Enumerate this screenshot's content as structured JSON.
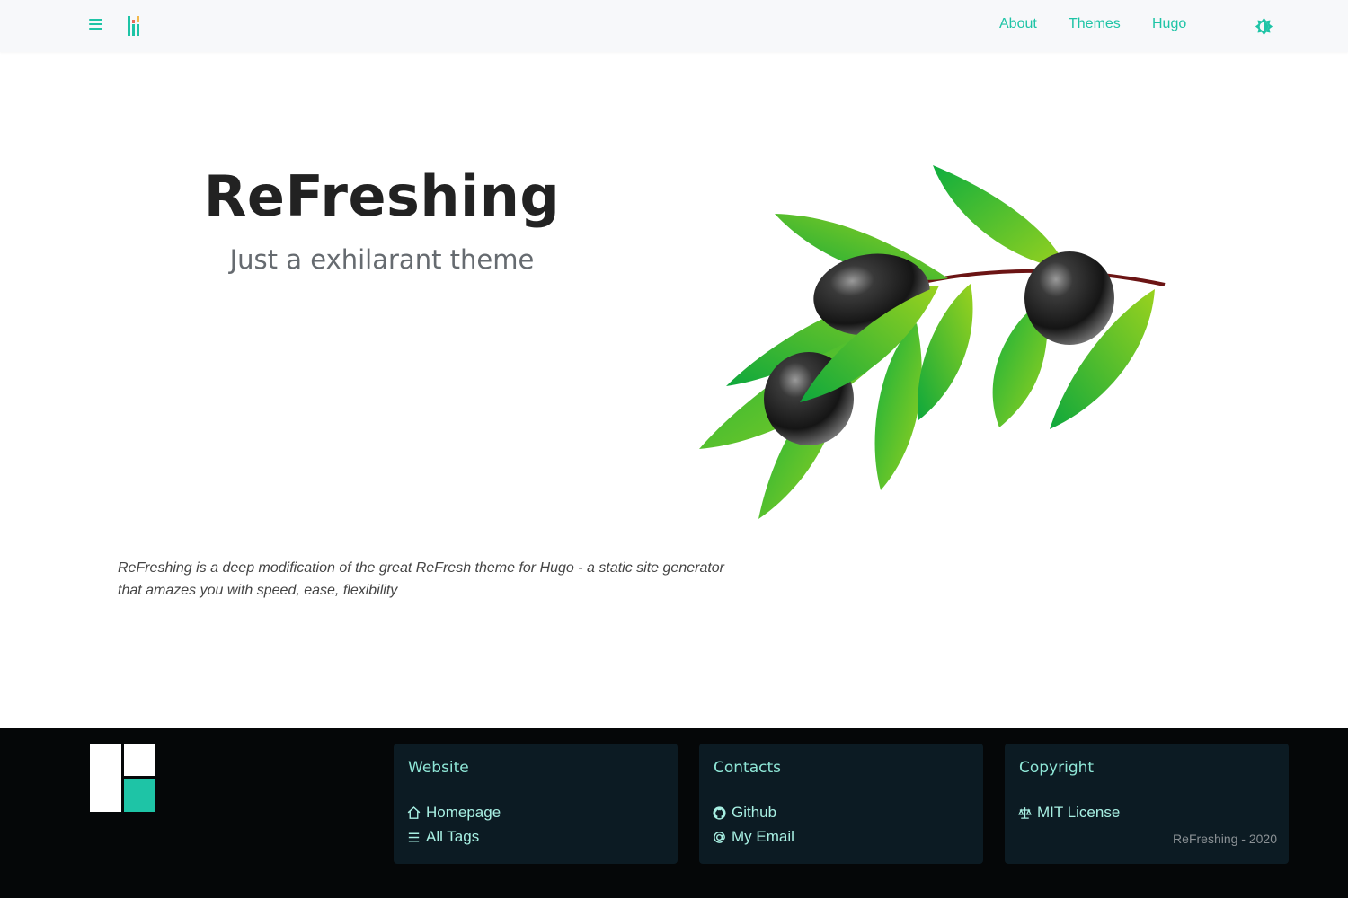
{
  "header": {
    "menu_icon": "hamburger-menu-icon",
    "brand_icon": "refreshing-brand-icon",
    "nav": [
      {
        "label": "About"
      },
      {
        "label": "Themes"
      },
      {
        "label": "Hugo"
      }
    ],
    "theme_toggle_icon": "brightness-icon"
  },
  "hero": {
    "title": "ReFreshing",
    "subtitle": "Just a exhilarant theme",
    "image": "olive-branch-illustration",
    "description_line1": "ReFreshing is a deep modification of the great ReFresh theme for Hugo - a static site generator",
    "description_line2": "that amazes you with speed, ease, flexibility"
  },
  "footer": {
    "logo": "refreshing-logo",
    "website": {
      "title": "Website",
      "links": [
        {
          "label": "Homepage",
          "icon": "home-icon"
        },
        {
          "label": "All Tags",
          "icon": "list-icon"
        }
      ]
    },
    "contacts": {
      "title": "Contacts",
      "links": [
        {
          "label": "Github",
          "icon": "github-icon"
        },
        {
          "label": "My Email",
          "icon": "at-sign-icon"
        }
      ]
    },
    "copyright": {
      "title": "Copyright",
      "links": [
        {
          "label": "MIT License",
          "icon": "scale-icon"
        }
      ],
      "tagline": "ReFreshing - 2020"
    }
  },
  "colors": {
    "accent": "#1ec4a6",
    "footer_bg": "#050708",
    "card_bg": "#0c1b23",
    "footer_text": "#a8f0e3"
  }
}
